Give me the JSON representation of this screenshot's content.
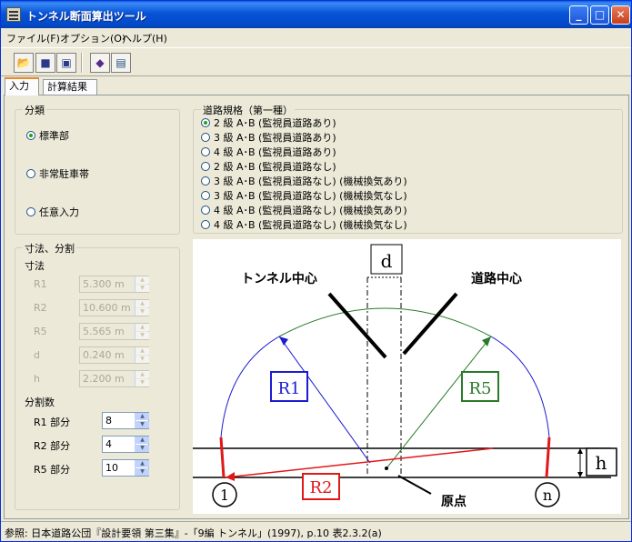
{
  "window": {
    "title": "トンネル断面算出ツール"
  },
  "menu": {
    "file": "ファイル(F)",
    "options": "オプション(O)",
    "help": "ヘルプ(H)"
  },
  "tabs": {
    "input": "入力",
    "results": "計算結果"
  },
  "classification": {
    "group_label": "分類",
    "options": [
      "標準部",
      "非常駐車帯",
      "任意入力"
    ],
    "selected": 0
  },
  "road_standard": {
    "group_label": "道路規格（第一種）",
    "options": [
      "2 級 A･B (監視員道路あり)",
      "3 級 A･B (監視員道路あり)",
      "4 級 A･B (監視員道路あり)",
      "2 級 A･B (監視員道路なし)",
      "3 級 A･B (監視員道路なし) (機械換気あり)",
      "3 級 A･B (監視員道路なし) (機械換気なし)",
      "4 級 A･B (監視員道路なし) (機械換気あり)",
      "4 級 A･B (監視員道路なし) (機械換気なし)"
    ],
    "selected": 0
  },
  "dimensions": {
    "group_label": "寸法、分割",
    "sub_label": "寸法",
    "fields": [
      {
        "label": "R1",
        "value": "5.300  m"
      },
      {
        "label": "R2",
        "value": "10.600  m"
      },
      {
        "label": "R5",
        "value": "5.565  m"
      },
      {
        "label": "d",
        "value": "0.240  m"
      },
      {
        "label": "h",
        "value": "2.200  m"
      }
    ],
    "division_label": "分割数",
    "divisions": [
      {
        "label": "R1 部分",
        "value": "8"
      },
      {
        "label": "R2 部分",
        "value": "4"
      },
      {
        "label": "R5 部分",
        "value": "10"
      }
    ]
  },
  "diagram": {
    "d_label": "d",
    "tunnel_center": "トンネル中心",
    "road_center": "道路中心",
    "r1": "R1",
    "r2": "R2",
    "r5": "R5",
    "h_label": "h",
    "origin": "原点",
    "point_1": "1",
    "point_n": "n",
    "colors": {
      "r1": "#1c1cd0",
      "r2": "#e01818",
      "r5": "#2a7a2a"
    }
  },
  "status": {
    "text": "参照: 日本道路公団『設計要領 第三集』-「9編 トンネル」(1997), p.10 表2.3.2(a)"
  }
}
